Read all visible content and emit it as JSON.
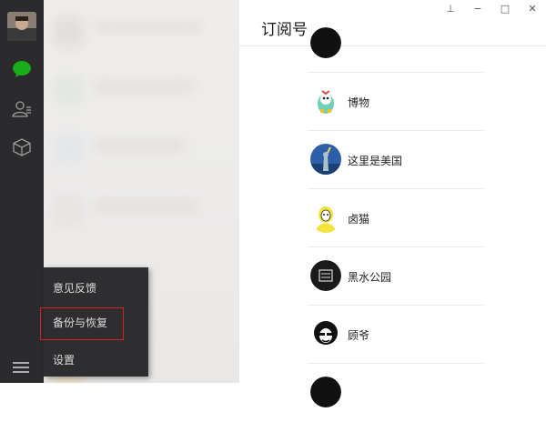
{
  "pane": {
    "title": "订阅号"
  },
  "window_controls": {
    "pin": "⊥",
    "minimize": "−",
    "maximize": "□",
    "close": "✕"
  },
  "popup": {
    "items": [
      {
        "label": "意见反馈"
      },
      {
        "label": "备份与恢复"
      },
      {
        "label": "设置"
      }
    ]
  },
  "subscriptions": [
    {
      "name": ""
    },
    {
      "name": "博物"
    },
    {
      "name": "这里是美国"
    },
    {
      "name": "卤猫"
    },
    {
      "name": "黑水公园"
    },
    {
      "name": "顾爷"
    },
    {
      "name": ""
    }
  ],
  "colors": {
    "sidebar": "#2b2b2e",
    "chat_active": "#1aad19",
    "highlight": "#d22222"
  },
  "icons": [
    "chat-icon",
    "contacts-icon",
    "favorites-icon",
    "menu-icon"
  ]
}
